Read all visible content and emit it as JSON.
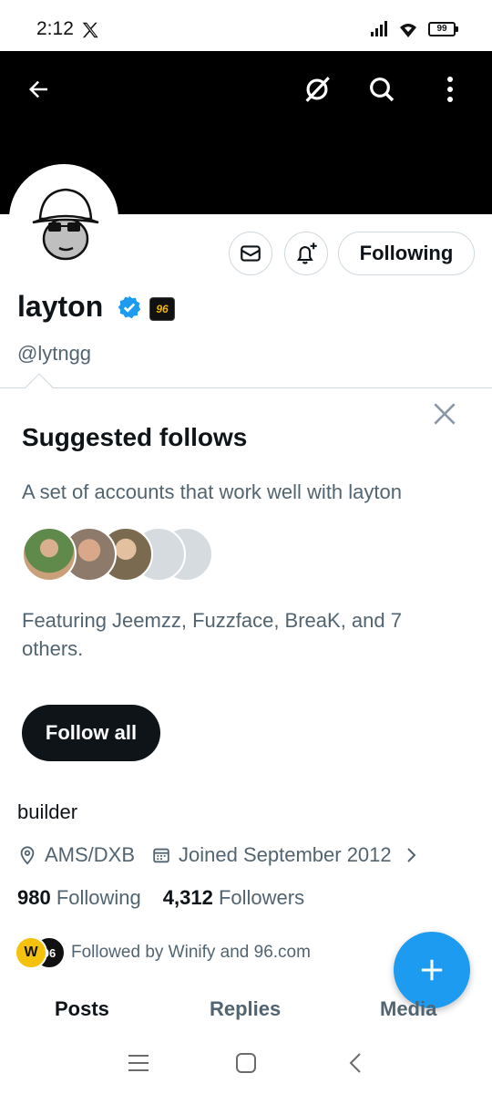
{
  "status_bar": {
    "time": "2:12",
    "battery": "99"
  },
  "top_bar": {
    "back_icon": "arrow-left-icon",
    "grok_icon": "grok-icon",
    "search_icon": "search-icon",
    "more_icon": "more-vertical-icon"
  },
  "profile": {
    "display_name": "layton",
    "handle": "@lytngg",
    "org_badge": "96",
    "following_button": "Following",
    "bio": "builder",
    "location": "AMS/DXB",
    "joined": "Joined September 2012",
    "following_count": "980",
    "following_label": "Following",
    "followers_count": "4,312",
    "followers_label": "Followers",
    "followed_by": "Followed by Winify and 96.com",
    "followed_by_avatars": [
      "W",
      "96"
    ]
  },
  "suggested": {
    "title": "Suggested follows",
    "subtitle": "A set of accounts that work well with layton",
    "featuring": "Featuring Jeemzz, Fuzzface, BreaK, and 7 others.",
    "follow_all": "Follow all"
  },
  "tabs": [
    "Posts",
    "Replies",
    "Media"
  ],
  "colors": {
    "accent": "#1d9bf0",
    "text": "#0f1419",
    "muted": "#536471",
    "border": "#cfd9de"
  }
}
